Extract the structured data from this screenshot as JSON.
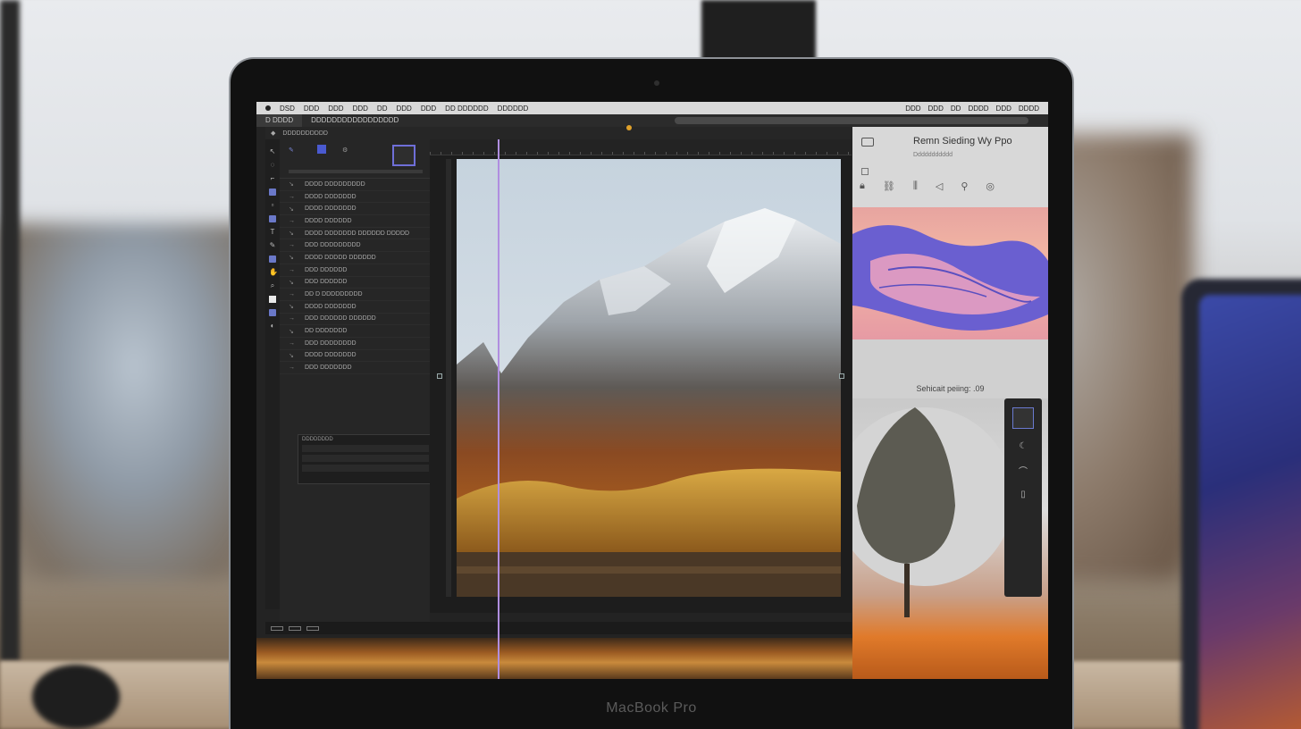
{
  "device": {
    "brand": "MacBook Pro"
  },
  "menubar": {
    "items": [
      "DSD",
      "DDD",
      "DDD",
      "DDD",
      "DD",
      "DDD",
      "DDD",
      "DD DDDDDD",
      "DDDDDD"
    ],
    "right_items": [
      "DDD",
      "DDD",
      "DD",
      "DDDD",
      "DDD",
      "DDDD"
    ]
  },
  "tabbar": {
    "active_tab": "D DDDD",
    "second_tab": "DDDDDDDDDDDDDDDDD"
  },
  "optbar": {
    "text": "DDDDDDDDDD"
  },
  "layers": {
    "rows": [
      {
        "icon": "↘",
        "name": "DDDD  DDDDDDDDD"
      },
      {
        "icon": "→",
        "name": "DDDD  DDDDDDD"
      },
      {
        "icon": "↘",
        "name": "DDDD  DDDDDDD"
      },
      {
        "icon": "→",
        "name": "DDDD  DDDDDD"
      },
      {
        "icon": "↘",
        "name": "DDDD  DDDDDDD DDDDDD DDDDD"
      },
      {
        "icon": "→",
        "name": "DDD  DDDDDDDDD"
      },
      {
        "icon": "↘",
        "name": "DDDD  DDDDD DDDDDD"
      },
      {
        "icon": "→",
        "name": "DDD  DDDDDD"
      },
      {
        "icon": "↘",
        "name": "DDD  DDDDDD"
      },
      {
        "icon": "→",
        "name": "DD  D DDDDDDDDD"
      },
      {
        "icon": "↘",
        "name": "DDDD  DDDDDDD"
      },
      {
        "icon": "→",
        "name": "DDD  DDDDDD DDDDDD"
      },
      {
        "icon": "↘",
        "name": "DD  DDDDDDD"
      },
      {
        "icon": "→",
        "name": "DDD  DDDDDDDD"
      },
      {
        "icon": "↘",
        "name": "DDDD  DDDDDDD"
      },
      {
        "icon": "→",
        "name": "DDD  DDDDDDD"
      }
    ],
    "sub_panel_title": "DDDDDDDD"
  },
  "right_panel": {
    "title": "Remn Sieding Wy Ppo",
    "subtitle": "Ddddddddddd",
    "caption": "Sehicait peiing: .09"
  },
  "colors": {
    "accent": "#6f6fd8",
    "guide": "#b08ee0",
    "marker": "#e0a12a"
  }
}
